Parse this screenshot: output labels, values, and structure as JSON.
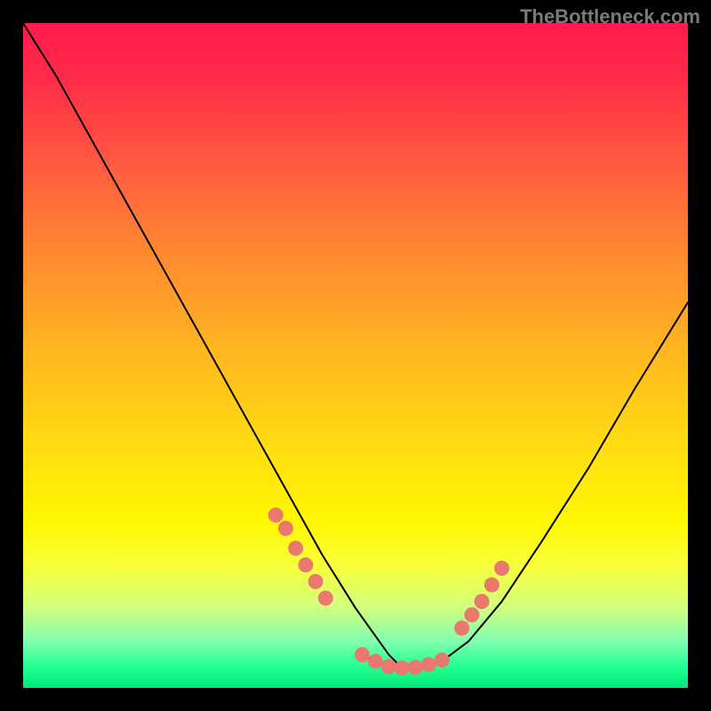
{
  "watermark": "TheBottleneck.com",
  "chart_data": {
    "type": "line",
    "title": "",
    "xlabel": "",
    "ylabel": "",
    "xlim": [
      0,
      100
    ],
    "ylim": [
      0,
      100
    ],
    "background_gradient": {
      "top_color": "#ff1a4d",
      "mid_color": "#ffe010",
      "bottom_color": "#00e878",
      "description": "vertical gradient red→orange→yellow→green representing bottleneck severity"
    },
    "series": [
      {
        "name": "bottleneck-curve",
        "description": "V-shaped curve; minimum around x≈57",
        "x": [
          0,
          5,
          10,
          15,
          20,
          25,
          30,
          35,
          40,
          45,
          50,
          55,
          57,
          60,
          63,
          67,
          72,
          78,
          85,
          92,
          100
        ],
        "y": [
          100,
          92,
          83,
          74,
          65,
          56,
          47,
          38,
          29,
          20,
          12,
          5,
          3,
          3,
          4,
          7,
          13,
          22,
          33,
          45,
          58
        ],
        "color": "#000000",
        "stroke_width": 2
      },
      {
        "name": "left-dot-cluster",
        "type": "scatter",
        "description": "salmon dots on descending arm",
        "x": [
          38,
          39.5,
          41,
          42.5,
          44,
          45.5
        ],
        "y": [
          26,
          24,
          21,
          18.5,
          16,
          13.5
        ],
        "color": "#e9796f",
        "marker_size": 11
      },
      {
        "name": "valley-dot-cluster",
        "type": "scatter",
        "description": "salmon dots along valley floor",
        "x": [
          51,
          53,
          55,
          57,
          59,
          61,
          63
        ],
        "y": [
          5,
          4,
          3.2,
          3,
          3.1,
          3.5,
          4.2
        ],
        "color": "#e9796f",
        "marker_size": 11
      },
      {
        "name": "right-dot-cluster",
        "type": "scatter",
        "description": "salmon dots on ascending arm",
        "x": [
          66,
          67.5,
          69,
          70.5,
          72
        ],
        "y": [
          9,
          11,
          13,
          15.5,
          18
        ],
        "color": "#e9796f",
        "marker_size": 11
      }
    ]
  }
}
